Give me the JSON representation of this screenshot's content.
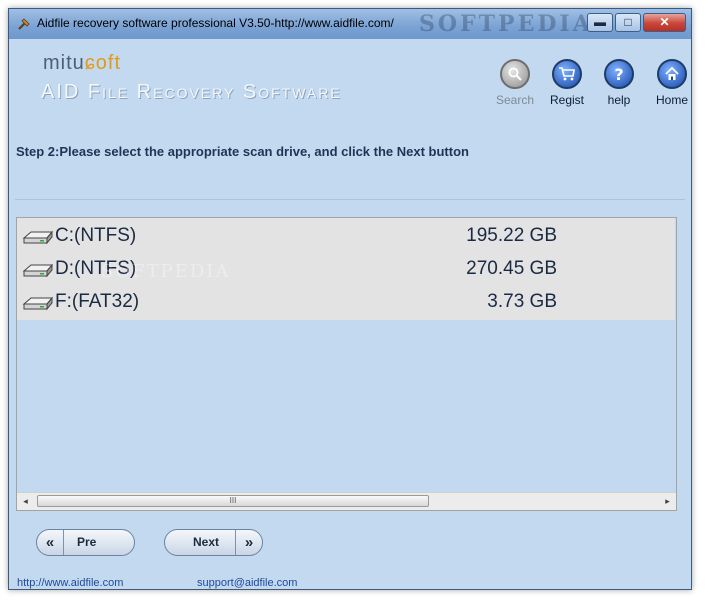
{
  "window": {
    "title": "Aidfile recovery software professional V3.50-http://www.aidfile.com/",
    "title_watermark": "SOFTPEDIA",
    "min_icon": "minimize-icon",
    "max_icon": "maximize-icon",
    "close_icon": "close-icon"
  },
  "logo": {
    "brand_prefix": "mitu",
    "brand_accent": "ɕoft",
    "product": "AID File Recovery Software"
  },
  "toolbar": [
    {
      "label": "Search",
      "icon": "search-icon"
    },
    {
      "label": "Regist",
      "icon": "cart-icon"
    },
    {
      "label": "help",
      "icon": "help-icon"
    },
    {
      "label": "Home",
      "icon": "home-icon"
    }
  ],
  "step_text": "Step 2:Please select the appropriate scan drive, and click the Next button",
  "drives": [
    {
      "name": "C:(NTFS)",
      "size": "195.22 GB",
      "icon": "drive-icon"
    },
    {
      "name": "D:(NTFS)",
      "size": "270.45 GB",
      "icon": "drive-icon"
    },
    {
      "name": "F:(FAT32)",
      "size": "3.73 GB",
      "icon": "drive-icon"
    }
  ],
  "list_watermark": "SOFTPEDIA",
  "scrollbar": {
    "left": "◂",
    "right": "▸",
    "grip": "III"
  },
  "buttons": {
    "pre_label": "Pre",
    "pre_arrow": "«",
    "next_label": "Next",
    "next_arrow": "»"
  },
  "footer": {
    "website": "http://www.aidfile.com",
    "email": "support@aidfile.com"
  },
  "colors": {
    "background": "#c3d9ef",
    "list_rows": "#e3e3e3",
    "link": "#1e4a9c",
    "step_text": "#1d3557",
    "accent": "#e29a1a"
  }
}
